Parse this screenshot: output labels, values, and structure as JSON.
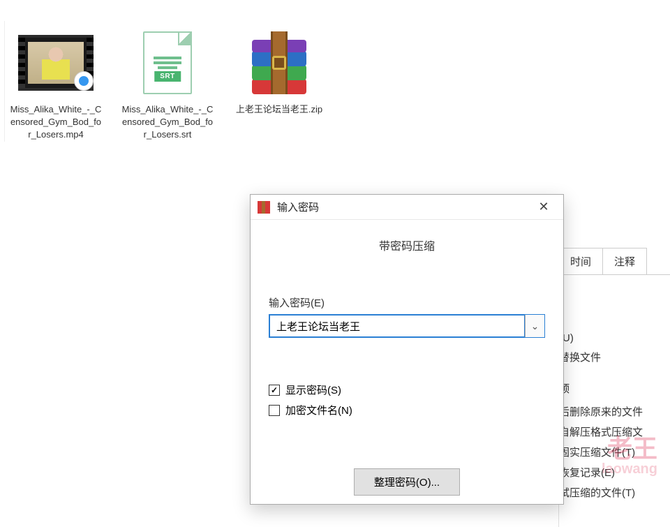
{
  "files": [
    {
      "name": "Miss_Alika_White_-_Censored_Gym_Bod_for_Losers.mp4",
      "type": "video"
    },
    {
      "name": "Miss_Alika_White_-_Censored_Gym_Bod_for_Losers.srt",
      "type": "srt",
      "badge": "SRT"
    },
    {
      "name": "上老王论坛当老王.zip",
      "type": "zip"
    }
  ],
  "dialog": {
    "title": "输入密码",
    "subtitle": "带密码压缩",
    "field_label": "输入密码(E)",
    "password_value": "上老王论坛当老王",
    "show_password_label": "显示密码(S)",
    "show_password_checked": true,
    "encrypt_names_label": "加密文件名(N)",
    "encrypt_names_checked": false,
    "organize_btn": "整理密码(O)..."
  },
  "right_panel": {
    "tabs": [
      "时间",
      "注释"
    ],
    "opt_u": "(U)",
    "opt_replace": "替换文件",
    "section": "顶",
    "items": [
      "后删除原来的文件",
      "自解压格式压缩文",
      "固实压缩文件(T)",
      "恢复记录(E)",
      "试压缩的文件(T)"
    ]
  },
  "watermark": {
    "main": "老王",
    "sub": "laowang"
  }
}
